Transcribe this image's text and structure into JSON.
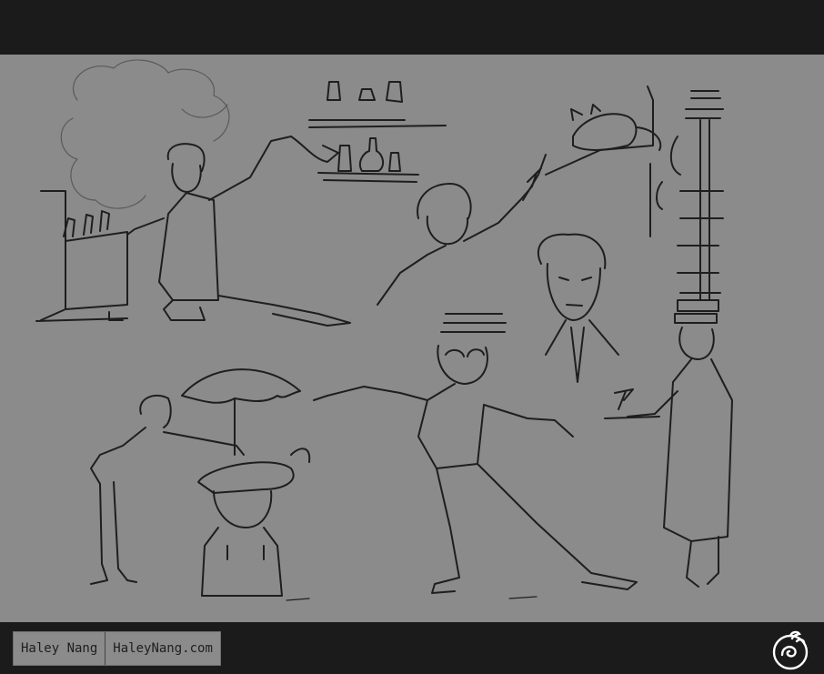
{
  "artist_name": "Haley Nang",
  "artist_site": "HaleyNang.com",
  "logo_icon": "swirl-sprout-logo-icon",
  "colors": {
    "background": "#1c1b1b",
    "paper": "#8b8b8b",
    "pencil": "#1e1e1e"
  }
}
